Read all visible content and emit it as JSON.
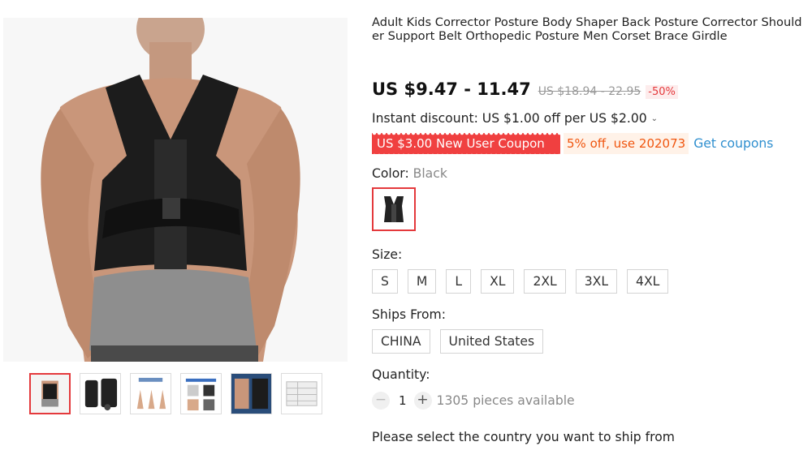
{
  "product": {
    "title": "Adult Kids Corrector Posture Body Shaper Back Posture Corrector Shoulder Support Belt Orthopedic Posture Men Corset Brace Girdle",
    "price": "US $9.47 - 11.47",
    "old_price": "US $18.94 - 22.95",
    "discount": "-50%"
  },
  "promo": {
    "instant_discount": "Instant discount: US $1.00 off per US $2.00",
    "new_user_coupon": "US $3.00 New User Coupon",
    "code_offer": "5% off, use 202073",
    "get_coupons": "Get coupons"
  },
  "color": {
    "label": "Color: ",
    "selected": "Black"
  },
  "size": {
    "label": "Size:",
    "options": [
      "S",
      "M",
      "L",
      "XL",
      "2XL",
      "3XL",
      "4XL"
    ]
  },
  "ships_from": {
    "label": "Ships From:",
    "options": [
      "CHINA",
      "United States"
    ]
  },
  "quantity": {
    "label": "Quantity:",
    "value": "1",
    "minus": "−",
    "plus": "+",
    "available": "1305 pieces available"
  },
  "ship_note": "Please select the country you want to ship from",
  "colors": {
    "accent_red": "#e4393c",
    "coupon_red": "#f04040",
    "coupon_orange": "#f0550e",
    "link_blue": "#2f8fcf"
  }
}
